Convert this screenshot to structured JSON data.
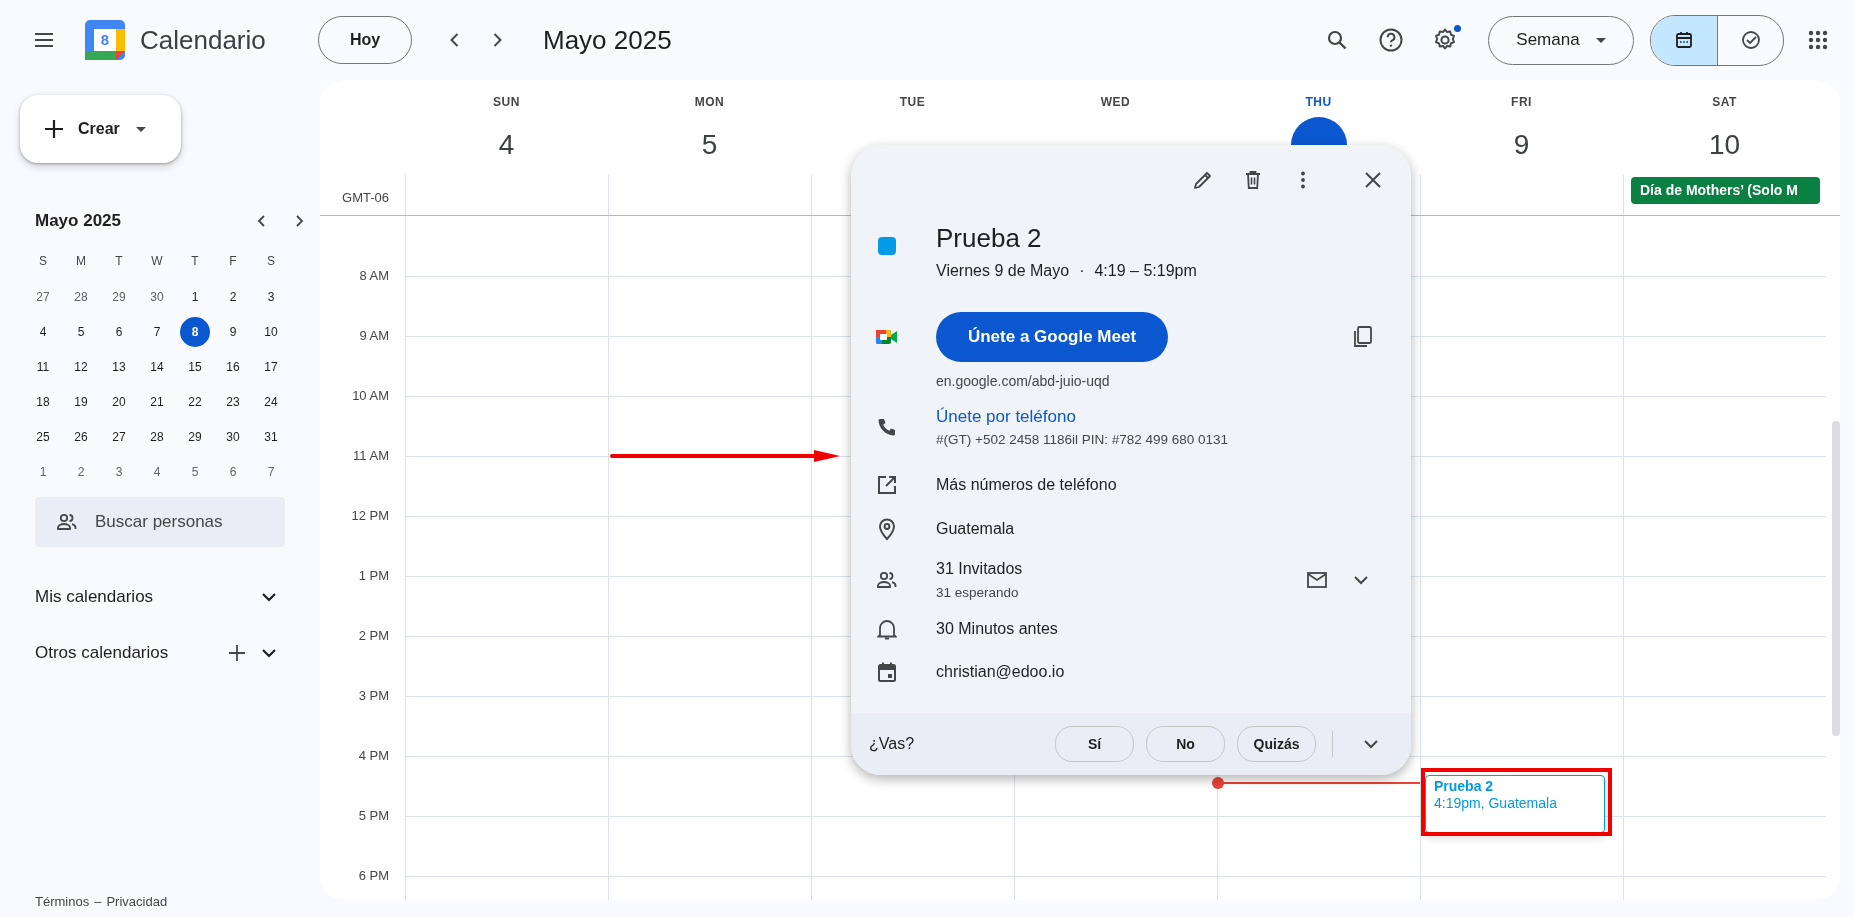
{
  "topbar": {
    "app_title": "Calendario",
    "logo_day": "8",
    "today_button": "Hoy",
    "period": "Mayo 2025",
    "settings_badge": true,
    "view_select": "Semana",
    "view_toggle": [
      {
        "kind": "calendar",
        "selected": true
      },
      {
        "kind": "tasks",
        "selected": false
      }
    ]
  },
  "sidebar": {
    "create_button": "Crear",
    "mini_calendar": {
      "title": "Mayo 2025",
      "weekdays": [
        "S",
        "M",
        "T",
        "W",
        "T",
        "F",
        "S"
      ],
      "weeks": [
        [
          {
            "day": "27",
            "muted": true,
            "selected": false
          },
          {
            "day": "28",
            "muted": true,
            "selected": false
          },
          {
            "day": "29",
            "muted": true,
            "selected": false
          },
          {
            "day": "30",
            "muted": true,
            "selected": false
          },
          {
            "day": "1",
            "muted": false,
            "selected": false
          },
          {
            "day": "2",
            "muted": false,
            "selected": false
          },
          {
            "day": "3",
            "muted": false,
            "selected": false
          }
        ],
        [
          {
            "day": "4",
            "muted": false,
            "selected": false
          },
          {
            "day": "5",
            "muted": false,
            "selected": false
          },
          {
            "day": "6",
            "muted": false,
            "selected": false
          },
          {
            "day": "7",
            "muted": false,
            "selected": false
          },
          {
            "day": "8",
            "muted": false,
            "selected": true
          },
          {
            "day": "9",
            "muted": false,
            "selected": false
          },
          {
            "day": "10",
            "muted": false,
            "selected": false
          }
        ],
        [
          {
            "day": "11",
            "muted": false,
            "selected": false
          },
          {
            "day": "12",
            "muted": false,
            "selected": false
          },
          {
            "day": "13",
            "muted": false,
            "selected": false
          },
          {
            "day": "14",
            "muted": false,
            "selected": false
          },
          {
            "day": "15",
            "muted": false,
            "selected": false
          },
          {
            "day": "16",
            "muted": false,
            "selected": false
          },
          {
            "day": "17",
            "muted": false,
            "selected": false
          }
        ],
        [
          {
            "day": "18",
            "muted": false,
            "selected": false
          },
          {
            "day": "19",
            "muted": false,
            "selected": false
          },
          {
            "day": "20",
            "muted": false,
            "selected": false
          },
          {
            "day": "21",
            "muted": false,
            "selected": false
          },
          {
            "day": "22",
            "muted": false,
            "selected": false
          },
          {
            "day": "23",
            "muted": false,
            "selected": false
          },
          {
            "day": "24",
            "muted": false,
            "selected": false
          }
        ],
        [
          {
            "day": "25",
            "muted": false,
            "selected": false
          },
          {
            "day": "26",
            "muted": false,
            "selected": false
          },
          {
            "day": "27",
            "muted": false,
            "selected": false
          },
          {
            "day": "28",
            "muted": false,
            "selected": false
          },
          {
            "day": "29",
            "muted": false,
            "selected": false
          },
          {
            "day": "30",
            "muted": false,
            "selected": false
          },
          {
            "day": "31",
            "muted": false,
            "selected": false
          }
        ],
        [
          {
            "day": "1",
            "muted": true,
            "selected": false
          },
          {
            "day": "2",
            "muted": true,
            "selected": false
          },
          {
            "day": "3",
            "muted": true,
            "selected": false
          },
          {
            "day": "4",
            "muted": true,
            "selected": false
          },
          {
            "day": "5",
            "muted": true,
            "selected": false
          },
          {
            "day": "6",
            "muted": true,
            "selected": false
          },
          {
            "day": "7",
            "muted": true,
            "selected": false
          }
        ]
      ]
    },
    "search_people": {
      "placeholder": "Buscar personas"
    },
    "sections": [
      {
        "label": "Mis calendarios",
        "add_button": false
      },
      {
        "label": "Otros calendarios",
        "add_button": true
      }
    ],
    "footer": {
      "links": [
        "Términos",
        "Privacidad"
      ],
      "separator": "–"
    }
  },
  "week": {
    "timezone": "GMT-06",
    "days": [
      {
        "name": "SUN",
        "number": "4",
        "today": false
      },
      {
        "name": "MON",
        "number": "5",
        "today": false
      },
      {
        "name": "TUE",
        "today": false
      },
      {
        "name": "WED",
        "today": false
      },
      {
        "name": "THU",
        "today": true,
        "now": true
      },
      {
        "name": "FRI",
        "number": "9",
        "today": false,
        "events": [
          {
            "title": "Prueba 2",
            "detail": "4:19pm, Guatemala",
            "color": "#039be5"
          }
        ]
      },
      {
        "name": "SAT",
        "number": "10",
        "today": false,
        "all_day": [
          {
            "title": "Día de Mothers’ (Solo M",
            "color": "#0b8043"
          }
        ]
      }
    ],
    "hours": [
      "8 AM",
      "9 AM",
      "10 AM",
      "11 AM",
      "12 PM",
      "1 PM",
      "2 PM",
      "3 PM",
      "4 PM",
      "5 PM",
      "6 PM"
    ]
  },
  "annotations": {
    "arrow": true,
    "highlight_frame": true
  },
  "popup": {
    "title": "Prueba 2",
    "color": "#039be5",
    "date": "Viernes 9 de Mayo",
    "separator": "·",
    "time": "4:19 – 5:19pm",
    "meet_button": "Únete a Google Meet",
    "meet_link": "en.google.com/abd-juio-uqd",
    "phone_link": "Únete por teléfono",
    "phone_detail": "#(GT) +502 2458 1186il PIN: #782 499 680 0131",
    "more_numbers": "Más números de teléfono",
    "location": "Guatemala",
    "guests": "31 Invitados",
    "guests_status": "31 esperando",
    "reminder": "30 Minutos antes",
    "calendar": "christian@edoo.io",
    "rsvp": {
      "question": "¿Vas?",
      "options": [
        {
          "label": "Sí",
          "selected": false
        },
        {
          "label": "No",
          "selected": false
        },
        {
          "label": "Quizás",
          "selected": false
        }
      ]
    }
  }
}
